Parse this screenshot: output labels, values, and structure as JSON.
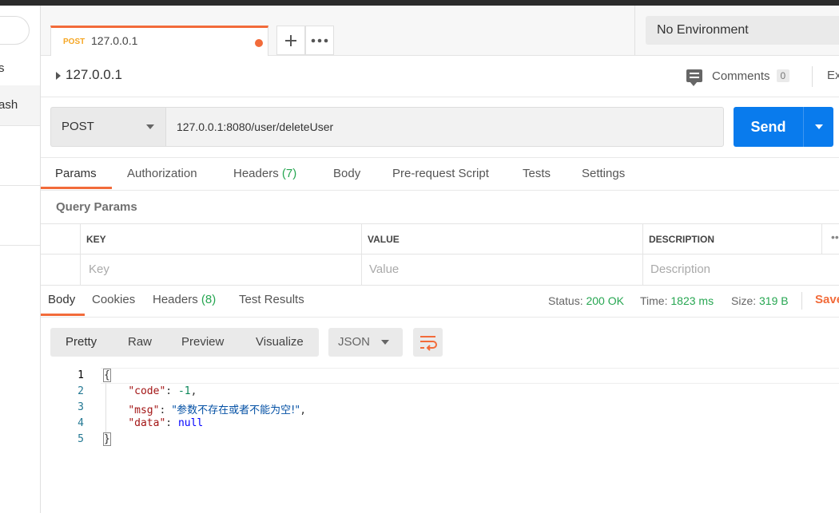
{
  "sidebar": {
    "partial_text_1": "s",
    "partial_text_2": "ash"
  },
  "tabs": {
    "active": {
      "method": "POST",
      "title": "127.0.0.1"
    },
    "add_icon": "plus-icon",
    "more_icon": "ellipsis-icon"
  },
  "environment": {
    "selected": "No Environment"
  },
  "breadcrumb": {
    "title": "127.0.0.1"
  },
  "comments": {
    "label": "Comments",
    "count": "0"
  },
  "export": {
    "label": "Ex"
  },
  "request": {
    "method": "POST",
    "url": "127.0.0.1:8080/user/deleteUser",
    "send_label": "Send"
  },
  "request_tabs": {
    "params": "Params",
    "authorization": "Authorization",
    "headers": "Headers",
    "headers_count": "(7)",
    "body": "Body",
    "prerequest": "Pre-request Script",
    "tests": "Tests",
    "settings": "Settings"
  },
  "query_params": {
    "label": "Query Params",
    "columns": [
      "KEY",
      "VALUE",
      "DESCRIPTION"
    ],
    "more": "•••",
    "placeholders": {
      "key": "Key",
      "value": "Value",
      "description": "Description"
    }
  },
  "response_tabs": {
    "body": "Body",
    "cookies": "Cookies",
    "headers": "Headers",
    "headers_count": "(8)",
    "test_results": "Test Results"
  },
  "response_status": {
    "status_label": "Status:",
    "status_value": "200 OK",
    "time_label": "Time:",
    "time_value": "1823 ms",
    "size_label": "Size:",
    "size_value": "319 B",
    "save_label": "Save"
  },
  "view_modes": {
    "pretty": "Pretty",
    "raw": "Raw",
    "preview": "Preview",
    "visualize": "Visualize",
    "format": "JSON"
  },
  "response_body": {
    "line_numbers": [
      "1",
      "2",
      "3",
      "4",
      "5"
    ],
    "open_brace": "{",
    "close_brace": "}",
    "code_key": "\"code\"",
    "code_value": "-1",
    "msg_key": "\"msg\"",
    "msg_value": "\"参数不存在或者不能为空!\"",
    "data_key": "\"data\"",
    "data_value": "null"
  },
  "colors": {
    "accent_orange": "#f26b3a",
    "send_blue": "#097bed",
    "success_green": "#26a651"
  }
}
